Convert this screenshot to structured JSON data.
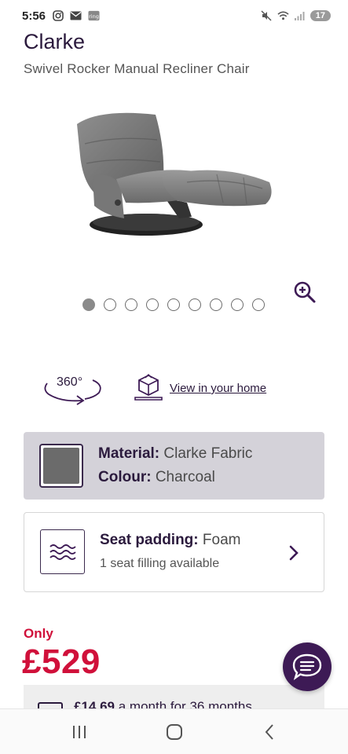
{
  "status_bar": {
    "time": "5:56",
    "battery": "17",
    "icons": [
      "instagram-icon",
      "mail-icon",
      "ring-icon",
      "mute-icon",
      "wifi-icon",
      "signal-icon"
    ]
  },
  "product": {
    "name": "Clarke",
    "subtitle": "Swivel Rocker Manual Recliner Chair"
  },
  "carousel": {
    "total_dots": 9,
    "active_index": 0
  },
  "views": {
    "label_360": "360°",
    "ar_link": "View in your home"
  },
  "material": {
    "material_label": "Material:",
    "material_value": "Clarke Fabric",
    "colour_label": "Colour:",
    "colour_value": "Charcoal",
    "swatch_color": "#6b6b6b"
  },
  "seat_padding": {
    "title_label": "Seat padding:",
    "title_value": "Foam",
    "subtitle": "1 seat filling available"
  },
  "price": {
    "only_label": "Only",
    "amount": "£529"
  },
  "finance": {
    "amount": "£14.69",
    "text": "a month for 36 months"
  },
  "colors": {
    "brand_purple": "#3d1a55",
    "price_red": "#d0103a",
    "material_card_bg": "#d4d2d9"
  }
}
